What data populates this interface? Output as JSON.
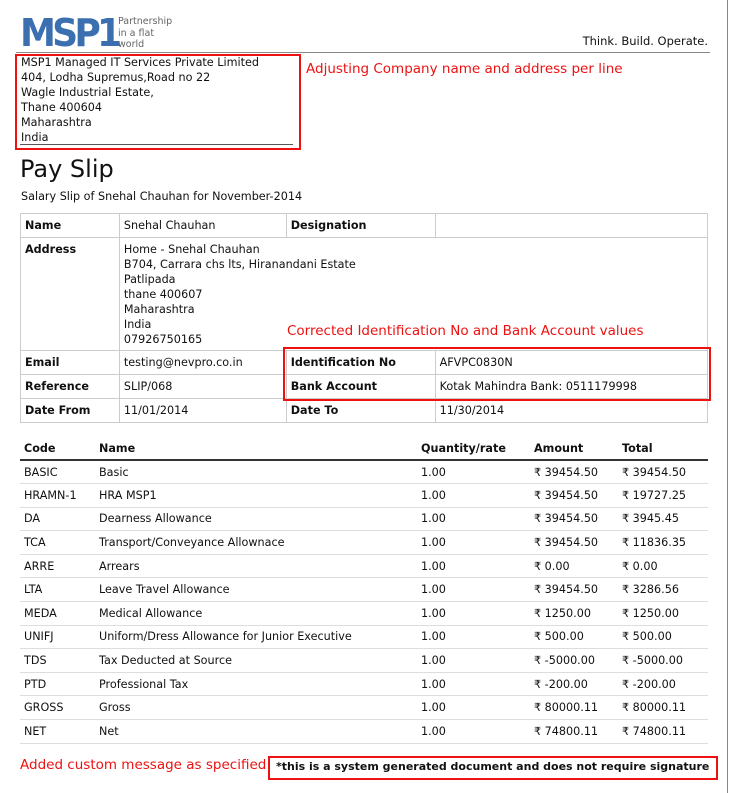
{
  "header": {
    "logo_text": "MSP1",
    "tagline": [
      "Partnership",
      "in a flat",
      "world"
    ],
    "motto": "Think. Build. Operate."
  },
  "company": {
    "lines": [
      "MSP1 Managed IT Services Private Limited",
      "404, Lodha Supremus,Road no 22",
      "Wagle Industrial Estate,",
      "Thane 400604",
      "Maharashtra",
      "India"
    ]
  },
  "annotations": {
    "company": "Adjusting Company name and address per line",
    "ids": "Corrected Identification No and Bank Account values",
    "footer": "Added custom message as specified"
  },
  "title": "Pay Slip",
  "subtitle": "Salary Slip of Snehal Chauhan for November-2014",
  "employee": {
    "name_label": "Name",
    "name": "Snehal Chauhan",
    "designation_label": "Designation",
    "designation": "",
    "address_label": "Address",
    "address_lines": [
      "Home - Snehal Chauhan",
      "B704, Carrara chs lts, Hiranandani Estate",
      "Patlipada",
      "thane 400607",
      "Maharashtra",
      "India",
      "07926750165"
    ],
    "email_label": "Email",
    "email": "testing@nevpro.co.in",
    "id_label": "Identification No",
    "id_value": "AFVPC0830N",
    "reference_label": "Reference",
    "reference": "SLIP/068",
    "bank_label": "Bank Account",
    "bank_value": "Kotak Mahindra Bank: 0511179998",
    "date_from_label": "Date From",
    "date_from": "11/01/2014",
    "date_to_label": "Date To",
    "date_to": "11/30/2014"
  },
  "earnings": {
    "headers": [
      "Code",
      "Name",
      "Quantity/rate",
      "Amount",
      "Total"
    ],
    "rows": [
      [
        "BASIC",
        "Basic",
        "1.00",
        "₹ 39454.50",
        "₹ 39454.50"
      ],
      [
        "HRAMN-1",
        "HRA MSP1",
        "1.00",
        "₹ 39454.50",
        "₹ 19727.25"
      ],
      [
        "DA",
        "Dearness Allowance",
        "1.00",
        "₹ 39454.50",
        "₹ 3945.45"
      ],
      [
        "TCA",
        "Transport/Conveyance Allownace",
        "1.00",
        "₹ 39454.50",
        "₹ 11836.35"
      ],
      [
        "ARRE",
        "Arrears",
        "1.00",
        "₹ 0.00",
        "₹ 0.00"
      ],
      [
        "LTA",
        "Leave Travel Allowance",
        "1.00",
        "₹ 39454.50",
        "₹ 3286.56"
      ],
      [
        "MEDA",
        "Medical Allowance",
        "1.00",
        "₹ 1250.00",
        "₹ 1250.00"
      ],
      [
        "UNIFJ",
        "Uniform/Dress Allowance for Junior Executive",
        "1.00",
        "₹ 500.00",
        "₹ 500.00"
      ],
      [
        "TDS",
        "Tax Deducted at Source",
        "1.00",
        "₹ -5000.00",
        "₹ -5000.00"
      ],
      [
        "PTD",
        "Professional Tax",
        "1.00",
        "₹ -200.00",
        "₹ -200.00"
      ],
      [
        "GROSS",
        "Gross",
        "1.00",
        "₹ 80000.11",
        "₹ 80000.11"
      ],
      [
        "NET",
        "Net",
        "1.00",
        "₹ 74800.11",
        "₹ 74800.11"
      ]
    ]
  },
  "footer_note": "*this is a system generated document and does not require signature",
  "colors": {
    "annotation": "#e11111",
    "logo": "#3b6fb0"
  }
}
